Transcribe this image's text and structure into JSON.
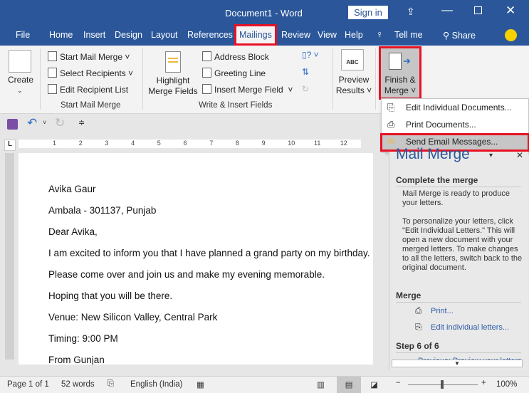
{
  "title": "Document1  -  Word",
  "sign_in": "Sign in",
  "tabs": [
    "File",
    "Home",
    "Insert",
    "Design",
    "Layout",
    "References",
    "Mailings",
    "Review",
    "View",
    "Help"
  ],
  "tell_me": "Tell me",
  "share": "Share",
  "ribbon": {
    "create": "Create",
    "start_mail_merge": "Start Mail Merge",
    "select_recipients": "Select Recipients",
    "edit_recipient_list": "Edit Recipient List",
    "group1": "Start Mail Merge",
    "highlight": [
      "Highlight",
      "Merge Fields"
    ],
    "address_block": "Address Block",
    "greeting_line": "Greeting Line",
    "insert_merge_field": "Insert Merge Field",
    "group2": "Write & Insert Fields",
    "preview": [
      "Preview",
      "Results"
    ],
    "preview_icon_text": "ABC",
    "finish": [
      "Finish &",
      "Merge"
    ]
  },
  "menu": [
    "Edit Individual Documents...",
    "Print Documents...",
    "Send Email Messages..."
  ],
  "ruler": [
    "1",
    "2",
    "3",
    "4",
    "5",
    "6",
    "7",
    "8",
    "9",
    "10",
    "11",
    "12"
  ],
  "document": [
    "Avika Gaur",
    "Ambala - 301137, Punjab",
    "Dear Avika,",
    "I am excited to inform you that I have planned a grand party on my birthday.",
    "Please come over and join us and make my evening memorable.",
    "Hoping that you will be there.",
    "Venue: New Silicon Valley, Central Park",
    "Timing: 9:00 PM",
    "From Gunjan"
  ],
  "pane": {
    "title": "Mail Merge",
    "h1": "Complete the merge",
    "p1": "Mail Merge is ready to produce your letters.",
    "p2": "To personalize your letters, click \"Edit Individual Letters.\" This will open a new document with your merged letters. To make changes to all the letters, switch back to the original document.",
    "h2": "Merge",
    "print": "Print...",
    "edit": "Edit individual letters...",
    "h3": "Step 6 of 6",
    "previous": "Previous: Preview your letters"
  },
  "status": {
    "page": "Page 1 of 1",
    "words": "52 words",
    "language": "English (India)",
    "zoom": "100%",
    "zoom_level": 100
  },
  "colors": {
    "brand": "#2b579a",
    "highlight": "#e81123"
  }
}
